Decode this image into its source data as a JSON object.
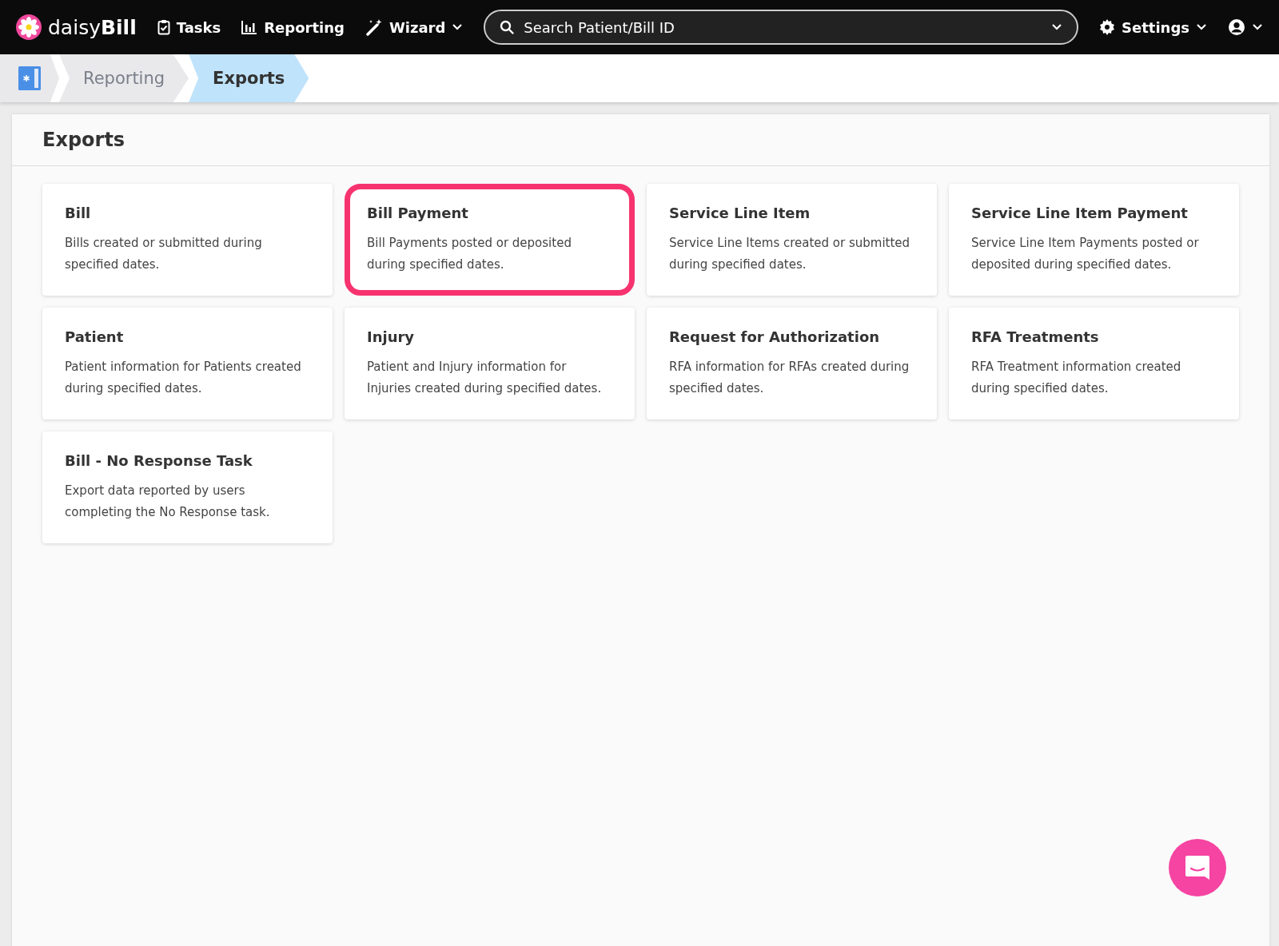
{
  "navbar": {
    "logo": {
      "light": "daisy",
      "bold": "Bill"
    },
    "items": [
      {
        "label": "Tasks",
        "kind": "tasks"
      },
      {
        "label": "Reporting",
        "kind": "reporting"
      },
      {
        "label": "Wizard",
        "kind": "wizard"
      }
    ],
    "search": {
      "placeholder": "Search Patient/Bill ID"
    },
    "settings": {
      "label": "Settings"
    }
  },
  "breadcrumb": [
    {
      "label": "Reporting",
      "selected": false
    },
    {
      "label": "Exports",
      "selected": true
    }
  ],
  "panel": {
    "title": "Exports",
    "cards": [
      {
        "title": "Bill",
        "description": "Bills created or submitted during specified dates.",
        "highlighted": false
      },
      {
        "title": "Bill Payment",
        "description": "Bill Payments posted or deposited during specified dates.",
        "highlighted": true
      },
      {
        "title": "Service Line Item",
        "description": "Service Line Items created or submitted during specified dates.",
        "highlighted": false
      },
      {
        "title": "Service Line Item Payment",
        "description": "Service Line Item Payments posted or deposited during specified dates.",
        "highlighted": false
      },
      {
        "title": "Patient",
        "description": "Patient information for Patients created during specified dates.",
        "highlighted": false
      },
      {
        "title": "Injury",
        "description": "Patient and Injury information for Injuries created during specified dates.",
        "highlighted": false
      },
      {
        "title": "Request for Authorization",
        "description": "RFA information for RFAs created during specified dates.",
        "highlighted": false
      },
      {
        "title": "RFA Treatments",
        "description": "RFA Treatment information created during specified dates.",
        "highlighted": false
      },
      {
        "title": "Bill - No Response Task",
        "description": "Export data reported by users completing the No Response task.",
        "highlighted": false
      }
    ]
  }
}
